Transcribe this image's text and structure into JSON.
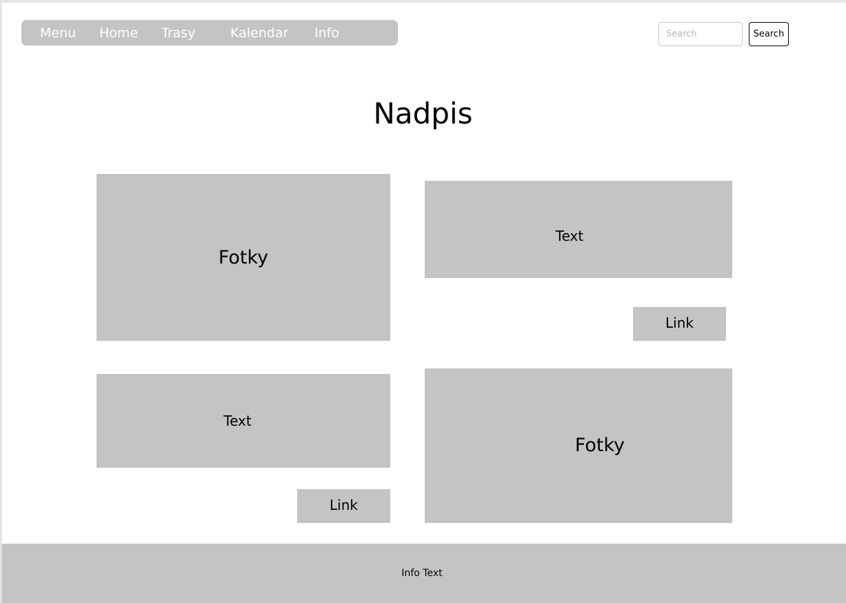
{
  "nav": {
    "items": [
      {
        "label": "Menu"
      },
      {
        "label": "Home"
      },
      {
        "label": "Trasy"
      },
      {
        "label": "Kalendar"
      },
      {
        "label": "Info"
      }
    ]
  },
  "search": {
    "placeholder": "Search",
    "value": "",
    "button_label": "Search"
  },
  "page": {
    "title": "Nadpis"
  },
  "content": {
    "photo_1": "Fotky",
    "text_1": "Text",
    "link_1": "Link",
    "text_2": "Text",
    "link_2": "Link",
    "photo_2": "Fotky"
  },
  "footer": {
    "text": "Info Text"
  },
  "colors": {
    "block_fill": "#c4c4c4",
    "background": "#ffffff",
    "nav_text": "#ffffff"
  }
}
